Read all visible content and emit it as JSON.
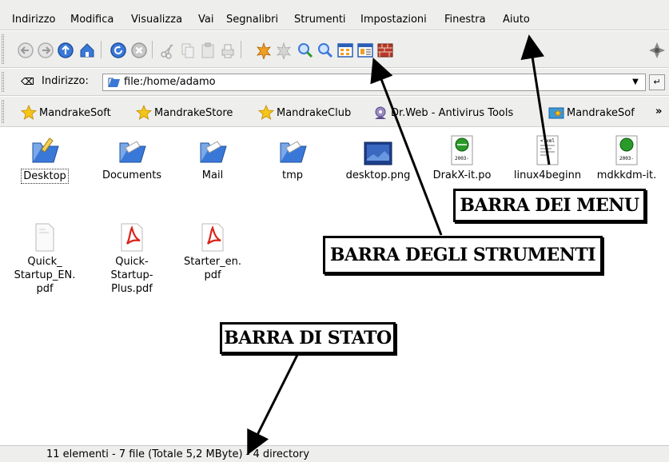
{
  "menubar": {
    "items": [
      "Indirizzo",
      "Modifica",
      "Visualizza",
      "Vai",
      "Segnalibri",
      "Strumenti",
      "Impostazioni",
      "Finestra",
      "Aiuto"
    ]
  },
  "toolbar": {
    "buttons": [
      "back",
      "forward",
      "up",
      "home",
      "reload",
      "stop",
      "cut",
      "copy",
      "paste",
      "print",
      "new-window",
      "close-window",
      "zoom-in",
      "zoom-out",
      "icon-view",
      "detail-view",
      "firewall"
    ]
  },
  "location": {
    "clear_label": "⌫",
    "label": "Indirizzo:",
    "value": "file:/home/adamo",
    "go_label": "↵"
  },
  "bookmarks": {
    "items": [
      "MandrakeSoft",
      "MandrakeStore",
      "MandrakeClub",
      "Dr.Web - Antivirus Tools",
      "MandrakeSof"
    ],
    "more": "»"
  },
  "files": [
    {
      "name": "Desktop",
      "kind": "folder"
    },
    {
      "name": "Documents",
      "kind": "folder"
    },
    {
      "name": "Mail",
      "kind": "folder"
    },
    {
      "name": "tmp",
      "kind": "folder"
    },
    {
      "name": "desktop.png",
      "kind": "image"
    },
    {
      "name": "DrakX-it.po",
      "kind": "po",
      "thumb": "2003-"
    },
    {
      "name": "linux4beginn",
      "kind": "xml",
      "thumb": "<?xml"
    },
    {
      "name": "mdkkdm-it.",
      "kind": "po",
      "thumb": "2003-"
    },
    {
      "name": "Quick_\nStartup_EN.\npdf",
      "kind": "text"
    },
    {
      "name": "Quick-\nStartup-\nPlus.pdf",
      "kind": "pdf"
    },
    {
      "name": "Starter_en.\npdf",
      "kind": "pdf"
    }
  ],
  "status": {
    "text": "11 elementi - 7 file (Totale 5,2 MByte) - 4 directory"
  },
  "annotations": {
    "menu": "BARRA DEI MENU",
    "tools": "BARRA DEGLI STRUMENTI",
    "status": "BARRA DI STATO"
  },
  "colors": {
    "bar_bg": "#eeeeec",
    "folder_blue": "#3a78d8",
    "pdf_red": "#d8241c",
    "star_yellow": "#f5c518"
  }
}
